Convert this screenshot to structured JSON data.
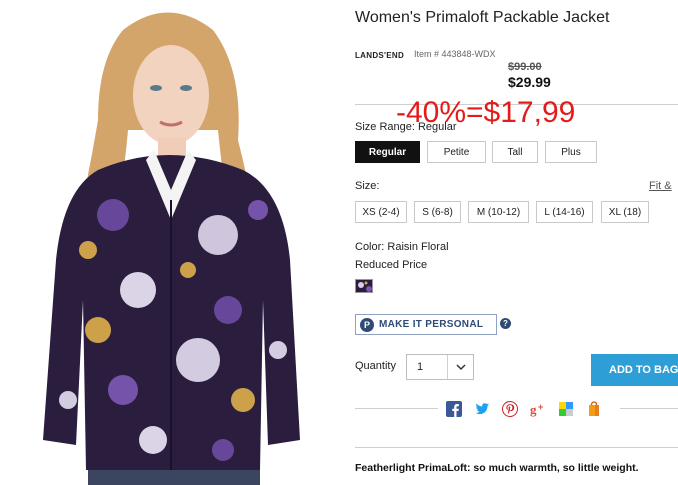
{
  "product": {
    "title": "Women's Primaloft Packable Jacket",
    "brand": "LANDS'END",
    "item_number": "Item # 443848-WDX",
    "original_price": "$99.00",
    "sale_price": "$29.99",
    "promo_overlay": "-40%=$17,99"
  },
  "size_range": {
    "label": "Size Range: Regular",
    "options": [
      "Regular",
      "Petite",
      "Tall",
      "Plus"
    ],
    "selected": "Regular"
  },
  "size": {
    "label": "Size:",
    "options": [
      "XS (2-4)",
      "S (6-8)",
      "M (10-12)",
      "L (14-16)",
      "XL (18)"
    ],
    "fit_link": "Fit &"
  },
  "color": {
    "label": "Color: Raisin Floral",
    "note": "Reduced Price",
    "swatch_icon": "raisin-floral-swatch"
  },
  "personalize": {
    "badge": "P",
    "label": "MAKE IT PERSONAL",
    "help": "?"
  },
  "quantity": {
    "label": "Quantity",
    "value": "1"
  },
  "cart": {
    "add_label": "ADD TO BAG"
  },
  "share_icons": [
    "facebook-icon",
    "twitter-icon",
    "pinterest-icon",
    "google-plus-icon",
    "delicious-icon",
    "shopping-bag-icon"
  ],
  "tagline": {
    "bold": "Featherlight PrimaLoft",
    "rest": ": so much warmth, so little weight."
  },
  "colors": {
    "accent_button": "#2e9fd6",
    "promo_red": "#e31b1b",
    "personal_blue": "#2e4b78",
    "jacket_purple": "#3a2a5c"
  }
}
